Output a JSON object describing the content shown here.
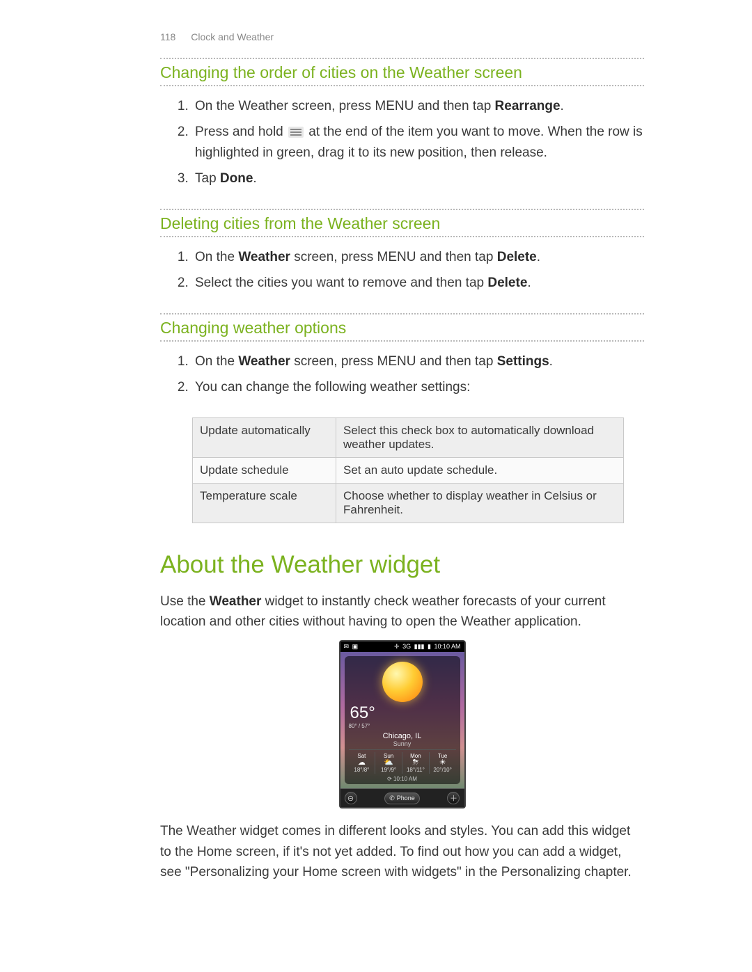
{
  "header": {
    "page_number": "118",
    "section": "Clock and Weather"
  },
  "sec1": {
    "title": "Changing the order of cities on the Weather screen",
    "steps": {
      "s1a": "On the Weather screen, press MENU and then tap ",
      "s1b": "Rearrange",
      "s1c": ".",
      "s2a": "Press and hold ",
      "s2b": " at the end of the item you want to move. When the row is highlighted in green, drag it to its new position, then release.",
      "s3a": "Tap ",
      "s3b": "Done",
      "s3c": "."
    }
  },
  "sec2": {
    "title": "Deleting cities from the Weather screen",
    "steps": {
      "s1a": "On the ",
      "s1b": "Weather",
      "s1c": " screen, press MENU and then tap ",
      "s1d": "Delete",
      "s1e": ".",
      "s2a": "Select the cities you want to remove and then tap ",
      "s2b": "Delete",
      "s2c": "."
    }
  },
  "sec3": {
    "title": "Changing weather options",
    "steps": {
      "s1a": "On the ",
      "s1b": "Weather",
      "s1c": " screen, press MENU and then tap ",
      "s1d": "Settings",
      "s1e": ".",
      "s2": "You can change the following weather settings:"
    },
    "table": [
      {
        "k": "Update automatically",
        "v": "Select this check box to automatically download weather updates."
      },
      {
        "k": "Update schedule",
        "v": "Set an auto update schedule."
      },
      {
        "k": "Temperature scale",
        "v": "Choose whether to display weather in Celsius or Fahrenheit."
      }
    ]
  },
  "sec4": {
    "title": "About the Weather widget",
    "p1a": "Use the ",
    "p1b": "Weather",
    "p1c": " widget to instantly check weather forecasts of your current location and other cities without having to open the Weather application.",
    "p2": "The Weather widget comes in different looks and styles. You can add this widget to the Home screen, if it's not yet added. To find out how you can add a widget, see \"Personalizing your Home screen with widgets\" in the Personalizing chapter."
  },
  "phone": {
    "status_time": "10:10 AM",
    "status_net": "3G",
    "temp": "65°",
    "hilo": "80° / 57°",
    "city": "Chicago, IL",
    "cond": "Sunny",
    "forecast": [
      {
        "day": "Sat",
        "icon": "☁",
        "t": "18°/8°"
      },
      {
        "day": "Sun",
        "icon": "⛅",
        "t": "19°/9°"
      },
      {
        "day": "Mon",
        "icon": "⛈",
        "t": "18°/11°"
      },
      {
        "day": "Tue",
        "icon": "☀",
        "t": "20°/10°"
      }
    ],
    "clock": "⟳ 10:10 AM",
    "dock_phone": "Phone"
  }
}
